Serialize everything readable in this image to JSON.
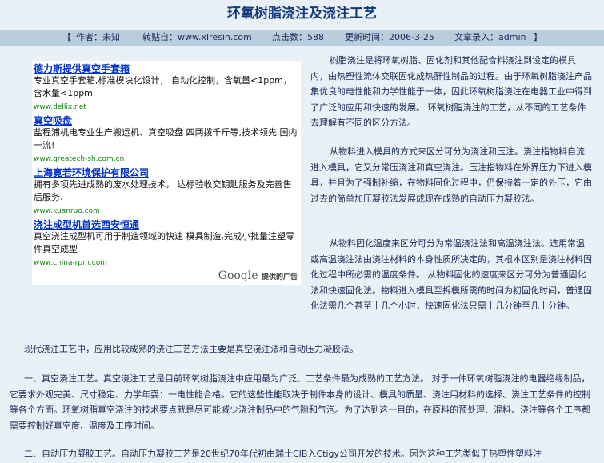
{
  "article": {
    "title": "环氧树脂浇注及浇注工艺",
    "info": {
      "bracket_open": "【",
      "author": "作者：未知",
      "source": "转贴自：www.xlresin.com",
      "clicks": "点击数：588",
      "updated": "更新时间：2006-3-25",
      "editor": "文章录入：admin",
      "bracket_close": "】"
    },
    "paragraphs": [
      "树脂浇注是将环氧树脂、固化剂和其他配合料浇注到设定的模具内，由热塑性流体交联固化成热酐性制品的过程。由于环氧树脂浇注产品集优良的电性能和力学性能于一体，因此环氧树脂浇注在电器工业中得到了广泛的应用和快速的发展。 环氧树脂浇注的工艺，从不同的工艺条件去理解有不同的区分方法。",
      "从物料进入模具的方式来区分可分为浇注和压注。浇注指物料自流进入模具，它又分常压浇注和真空浇注。压注指物料在外界压力下进入模具，并且为了强制补缩，在物料固化过程中，仍保持着一定的外压，它由过去的简单加压凝胶法发展成现在成熟的自动压力凝胶法。",
      "从物料固化温度来区分可分为常温浇注法和高温浇注法。选用常温或高温浇注法由浇注材料的本身性质所决定的，其根本区别是浇注材料固化过程中所必需的温度条件。 从物料固化的速度来区分可分为普通固化法和快速固化法。物料进入模具至拆模所需的时间为初固化时间，普通固化法需几个甚至十几个小时，快速固化法只需十几分钟至几十分钟。",
      "现代浇注工艺中，应用比较成熟的浇注工艺方法主要是真空浇注法和自动压力凝胶法。",
      "一、真空浇注工艺。真空浇注工艺是目前环氧树脂浇注中应用最为广泛、工艺条件最为成熟的工艺方法。 对于一件环氧树脂浇注的电器绝缘制品，它要求外观完美、尺寸稳定、力学年耍：一电性能合格。它的这些性能取决于制件本身的设计、模具的质量、浇注用材料的选择、浇注工艺条件的控制等各个方面。环氧树脂真空浇注的技术要点就是尽可能减少浇注制品中的气隙和气泡。为了达到这一目的，在原料的预处理、混料、浇注等各个工序都需要控制好真空度、温度及工序时间。",
      "二、自动压力凝胶工艺。自动压力凝胶工艺是20世纪70年代初由瑞士CIB入Ctigy公司开发的技术。因为这种工艺类似于热塑性塑料注"
    ]
  },
  "ads": [
    {
      "title": "德力斯提供真空手套箱",
      "desc": "专业真空手套箱,标准模块化设计， 自动化控制，含氧量<1ppm，含水量<1ppm",
      "url": "www.dellix.net"
    },
    {
      "title": "真空吸盘",
      "desc": "盐程浦机电专业生产搬运机、真空吸盘 四两拨千斤等,技术领先,国内一流!",
      "url": "www.greatech-sh.com.cn"
    },
    {
      "title": "上海寛若环境保护有限公司",
      "desc": "拥有多项先进成熟的废水处理技术， 达标验收交钥匙服务及完善售后服务.",
      "url": "www.kuanruo.com"
    },
    {
      "title": "浇注成型机首选西安恒通",
      "desc": "真空浇注成型机可用于制造领域的快速 模具制造,完成小批量注塑零件真空成型",
      "url": "www.china-rpm.com"
    }
  ],
  "ad_footer": {
    "brand": "Google",
    "label": "提供的广告"
  }
}
